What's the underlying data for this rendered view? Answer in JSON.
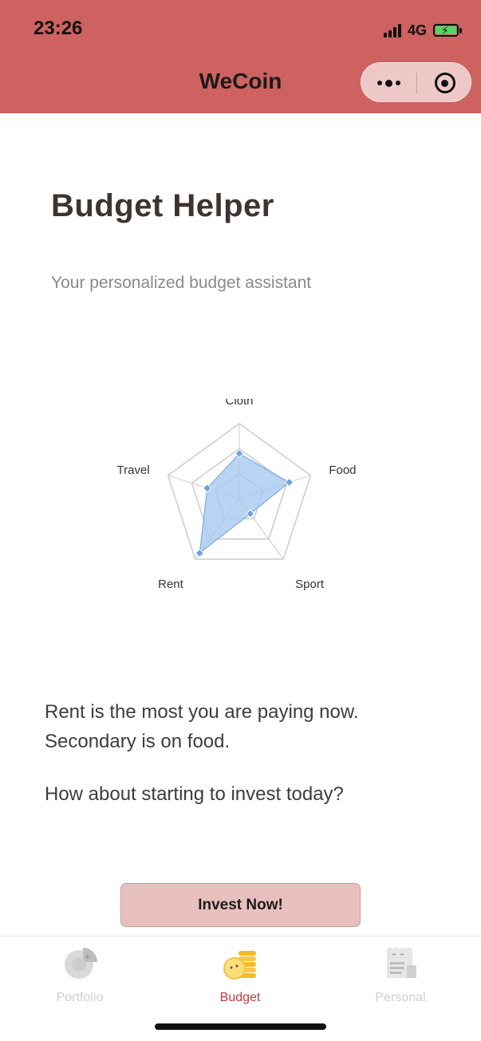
{
  "status": {
    "time": "23:26",
    "network": "4G"
  },
  "nav": {
    "title": "WeCoin",
    "more_icon": "ellipsis-icon",
    "close_icon": "target-icon"
  },
  "page": {
    "heading": "Budget Helper",
    "subheading": "Your personalized budget assistant",
    "insight_line1": "Rent is the most you are paying now.",
    "insight_line2": "Secondary is on food.",
    "question": "How about starting to invest today?",
    "button_label": "Invest Now!"
  },
  "chart_data": {
    "type": "radar",
    "categories": [
      "Cloth",
      "Food",
      "Sport",
      "Rent",
      "Travel"
    ],
    "values": [
      0.6,
      0.7,
      0.25,
      0.9,
      0.45
    ],
    "max": 1,
    "rings": 3,
    "fill_color": "#A8C8F0",
    "point_color": "#6FA0DC",
    "grid_color": "#cccccc"
  },
  "tabs": [
    {
      "label": "Portfolio",
      "icon": "pie-chart-icon",
      "active": false
    },
    {
      "label": "Budget",
      "icon": "coin-stack-icon",
      "active": true
    },
    {
      "label": "Personal",
      "icon": "document-icon",
      "active": false
    }
  ],
  "colors": {
    "header": "#CD6260",
    "button": "#E8C0BE",
    "active_tab": "#C0393F"
  }
}
